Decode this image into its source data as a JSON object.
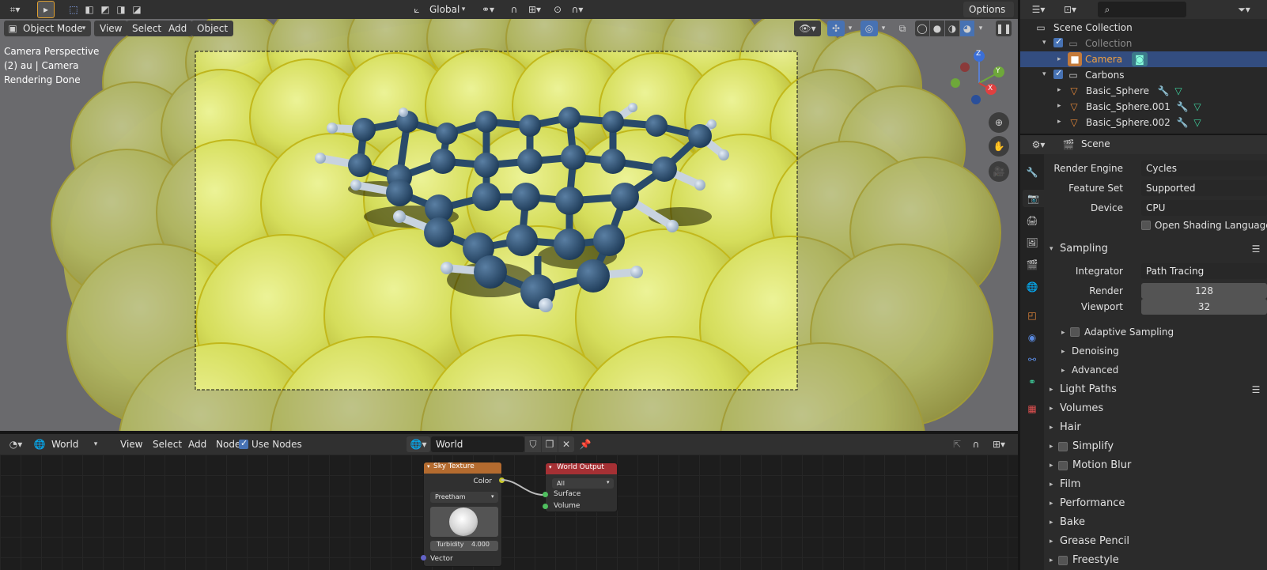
{
  "topbar": {
    "transform_orientation": "Global",
    "options_label": "Options"
  },
  "viewport": {
    "mode": "Object Mode",
    "menu": [
      "View",
      "Select",
      "Add",
      "Object"
    ],
    "overlay_lines": [
      "Camera Perspective",
      "(2) au | Camera",
      "Rendering Done"
    ],
    "gizmo_axes": [
      "Z",
      "Y",
      "X"
    ]
  },
  "node_editor": {
    "world_select": "World",
    "menu": [
      "View",
      "Select",
      "Add",
      "Node"
    ],
    "use_nodes_label": "Use Nodes",
    "world_name": "World",
    "sky_node": {
      "title": "Sky Texture",
      "output": "Color",
      "model": "Preetham",
      "turbidity_label": "Turbidity",
      "turbidity_value": "4.000",
      "input": "Vector"
    },
    "output_node": {
      "title": "World Output",
      "target": "All",
      "inputs": [
        "Surface",
        "Volume"
      ]
    }
  },
  "outliner": {
    "root": "Scene Collection",
    "items": [
      {
        "label": "Collection"
      },
      {
        "label": "Camera"
      },
      {
        "label": "Carbons"
      },
      {
        "label": "Basic_Sphere"
      },
      {
        "label": "Basic_Sphere.001"
      },
      {
        "label": "Basic_Sphere.002"
      }
    ]
  },
  "properties": {
    "context": "Scene",
    "render_engine_label": "Render Engine",
    "render_engine": "Cycles",
    "feature_set_label": "Feature Set",
    "feature_set": "Supported",
    "device_label": "Device",
    "device": "CPU",
    "osl_label": "Open Shading Language",
    "sampling": {
      "title": "Sampling",
      "integrator_label": "Integrator",
      "integrator": "Path Tracing",
      "render_label": "Render",
      "render": "128",
      "viewport_label": "Viewport",
      "viewport": "32",
      "subpanels": [
        "Adaptive Sampling",
        "Denoising",
        "Advanced"
      ]
    },
    "panels": [
      "Light Paths",
      "Volumes",
      "Hair",
      "Simplify",
      "Motion Blur",
      "Film",
      "Performance",
      "Bake",
      "Grease Pencil",
      "Freestyle"
    ]
  }
}
